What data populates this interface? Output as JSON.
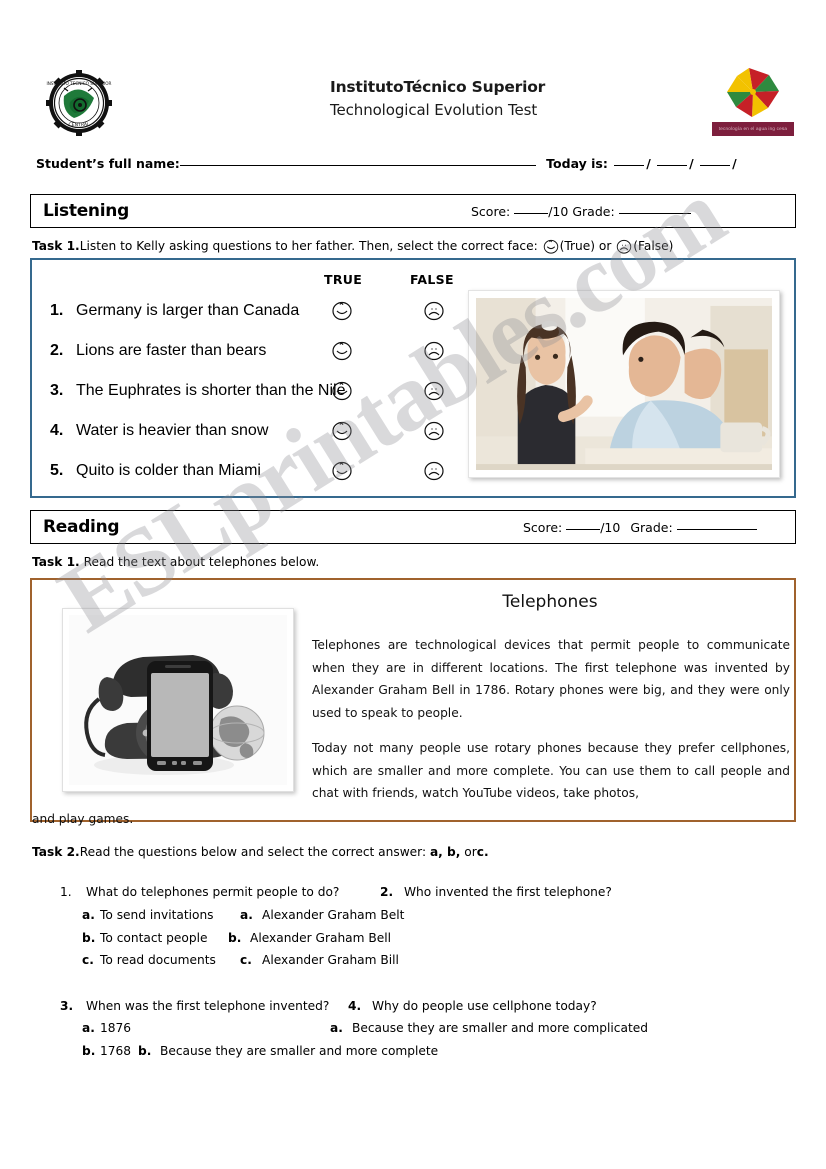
{
  "document": {
    "institution_title": "InstitutoTécnico Superior",
    "test_title": "Technological Evolution Test",
    "right_logo_caption": "tecnología en el agua ing cesa",
    "watermark": "ESLprintables.com"
  },
  "student_row": {
    "name_label": "Student’s full name:",
    "name_value": "",
    "today_label": "Today is:",
    "date_day": "",
    "date_month": "",
    "date_year": "",
    "slash": "/"
  },
  "listening": {
    "section_label": "Listening",
    "score_label": "Score:",
    "score_value": "",
    "score_total": "/10",
    "grade_label": "Grade:",
    "grade_value": "",
    "task_number": "Task 1.",
    "task_text": "Listen to Kelly asking questions to her father. Then, select the correct face:",
    "task_true_word": "(True) or",
    "task_false_word": "(False)",
    "column_true": "TRUE",
    "column_false": "FALSE",
    "questions": [
      {
        "num": "1.",
        "text": "Germany is larger than  Canada"
      },
      {
        "num": "2.",
        "text": "Lions are faster than bears"
      },
      {
        "num": "3.",
        "text": "The Euphrates is shorter than the Nile"
      },
      {
        "num": "4.",
        "text": "Water is heavier than snow"
      },
      {
        "num": "5.",
        "text": "Quito is colder than Miami"
      }
    ],
    "photo_alt": "girl-and-father-talking-photo"
  },
  "reading": {
    "section_label": "Reading",
    "score_label": "Score:",
    "score_value": "",
    "score_total": "/10",
    "grade_label": "Grade:",
    "grade_value": "",
    "task1_number": "Task 1.",
    "task1_text": "Read the text about telephones below.",
    "passage_title": "Telephones",
    "passage_p1": "Telephones are technological devices that permit people to communicate when they are in different locations. The first telephone was invented by Alexander Graham Bell in 1786. Rotary phones were big, and they were only used to speak to people.",
    "passage_p2": "Today not many people use rotary phones because they prefer cellphones, which are smaller and more complete. You can use them to call people and chat with friends, watch YouTube videos, take photos,",
    "passage_overflow": "and play games.",
    "photo_alt": "rotary-phone-smartphone-globe-photo",
    "task2_number": "Task 2.",
    "task2_text_a": "Read the questions below and select the correct answer:",
    "task2_text_b": "a, b,",
    "task2_text_c": "or",
    "task2_text_d": "c.",
    "questions": [
      {
        "num": "1.",
        "text": "What do telephones permit people to do?",
        "options": [
          {
            "letter": "a.",
            "text": "To send invitations"
          },
          {
            "letter": "b.",
            "text": "To contact people"
          },
          {
            "letter": "c.",
            "text": "To read documents"
          }
        ]
      },
      {
        "num": "2.",
        "text": "Who invented the first telephone?",
        "options": [
          {
            "letter": "a.",
            "text": "Alexander Graham Belt"
          },
          {
            "letter": "b.",
            "text": "Alexander Graham Bell"
          },
          {
            "letter": "c.",
            "text": "Alexander Graham Bill"
          }
        ]
      },
      {
        "num": "3.",
        "text": "When was the first telephone invented?",
        "options": [
          {
            "letter": "a.",
            "text": "1876"
          },
          {
            "letter": "b.",
            "text": "1768"
          }
        ]
      },
      {
        "num": "4.",
        "text": "Why do people use cellphone today?",
        "options": [
          {
            "letter": "a.",
            "text": "Because they are smaller and more complicated"
          },
          {
            "letter": "b.",
            "text": "Because they are smaller and more complete"
          }
        ]
      }
    ]
  },
  "colors": {
    "listening_border": "#35698e",
    "reading_border": "#a0622d",
    "logo_green": "#1f7a3a",
    "pinwheel_red": "#c62027",
    "pinwheel_yellow": "#f2c200",
    "pinwheel_green": "#2f8a3f",
    "pinwheel_label_bg": "#7d1f3d"
  }
}
